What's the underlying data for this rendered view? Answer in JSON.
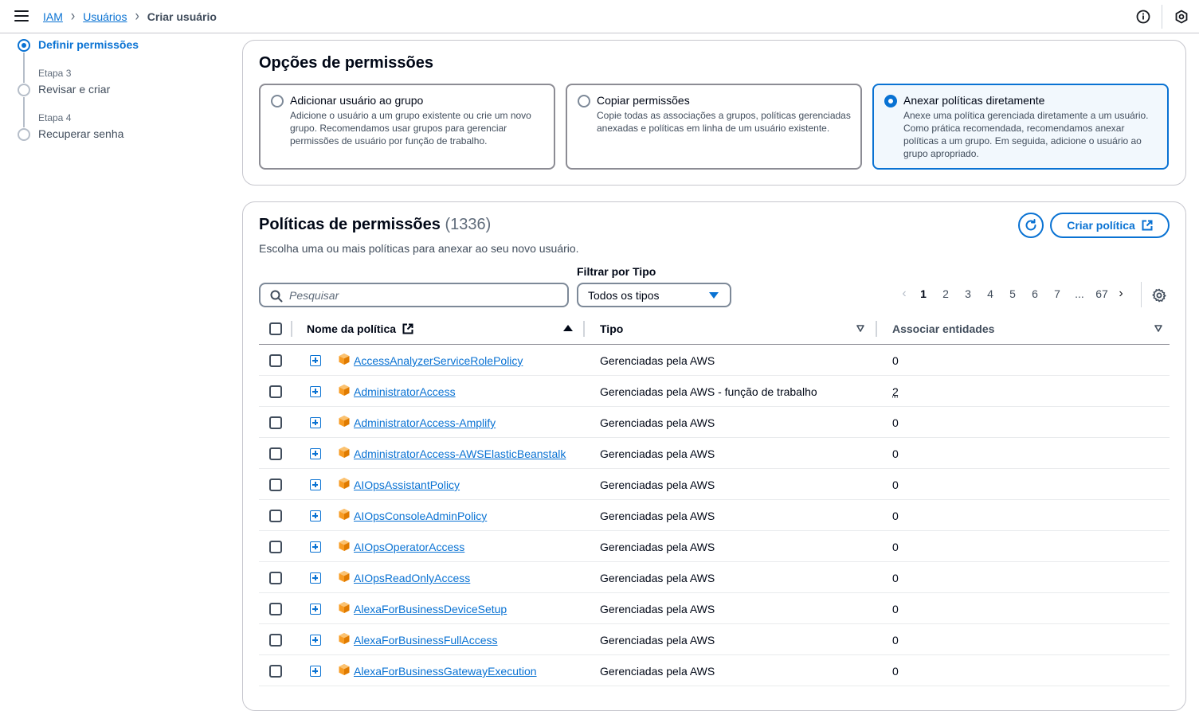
{
  "breadcrumb": {
    "root": "IAM",
    "parent": "Usuários",
    "current": "Criar usuário"
  },
  "steps": [
    {
      "sub": "",
      "title": "Definir permissões",
      "active": true
    },
    {
      "sub": "Etapa 3",
      "title": "Revisar e criar",
      "active": false
    },
    {
      "sub": "Etapa 4",
      "title": "Recuperar senha",
      "active": false
    }
  ],
  "permission_options": {
    "title": "Opções de permissões",
    "tiles": [
      {
        "title": "Adicionar usuário ao grupo",
        "desc": "Adicione o usuário a um grupo existente ou crie um novo grupo. Recomendamos usar grupos para gerenciar permissões de usuário por função de trabalho.",
        "selected": false
      },
      {
        "title": "Copiar permissões",
        "desc": "Copie todas as associações a grupos, políticas gerenciadas anexadas e políticas em linha de um usuário existente.",
        "selected": false
      },
      {
        "title": "Anexar políticas diretamente",
        "desc": "Anexe uma política gerenciada diretamente a um usuário. Como prática recomendada, recomendamos anexar políticas a um grupo. Em seguida, adicione o usuário ao grupo apropriado.",
        "selected": true
      }
    ]
  },
  "policies": {
    "title": "Políticas de permissões",
    "count": "(1336)",
    "subtitle": "Escolha uma ou mais políticas para anexar ao seu novo usuário.",
    "create_button": "Criar política",
    "filter_label": "Filtrar por Tipo",
    "search_placeholder": "Pesquisar",
    "filter_value": "Todos os tipos",
    "pagination": {
      "pages": [
        "1",
        "2",
        "3",
        "4",
        "5",
        "6",
        "7",
        "...",
        "67"
      ],
      "current": "1"
    },
    "columns": {
      "name": "Nome da política",
      "type": "Tipo",
      "entities": "Associar entidades"
    },
    "rows": [
      {
        "name": "AccessAnalyzerServiceRolePolicy",
        "type": "Gerenciadas pela AWS",
        "entities": "0"
      },
      {
        "name": "AdministratorAccess",
        "type": "Gerenciadas pela AWS - função de trabalho",
        "entities": "2"
      },
      {
        "name": "AdministratorAccess-Amplify",
        "type": "Gerenciadas pela AWS",
        "entities": "0"
      },
      {
        "name": "AdministratorAccess-AWSElasticBeanstalk",
        "type": "Gerenciadas pela AWS",
        "entities": "0"
      },
      {
        "name": "AIOpsAssistantPolicy",
        "type": "Gerenciadas pela AWS",
        "entities": "0"
      },
      {
        "name": "AIOpsConsoleAdminPolicy",
        "type": "Gerenciadas pela AWS",
        "entities": "0"
      },
      {
        "name": "AIOpsOperatorAccess",
        "type": "Gerenciadas pela AWS",
        "entities": "0"
      },
      {
        "name": "AIOpsReadOnlyAccess",
        "type": "Gerenciadas pela AWS",
        "entities": "0"
      },
      {
        "name": "AlexaForBusinessDeviceSetup",
        "type": "Gerenciadas pela AWS",
        "entities": "0"
      },
      {
        "name": "AlexaForBusinessFullAccess",
        "type": "Gerenciadas pela AWS",
        "entities": "0"
      },
      {
        "name": "AlexaForBusinessGatewayExecution",
        "type": "Gerenciadas pela AWS",
        "entities": "0"
      }
    ]
  },
  "icons": {
    "menu": "hamburger-icon",
    "info": "info-icon",
    "settings": "settings-icon",
    "refresh": "refresh-icon",
    "external": "external-link-icon",
    "search": "search-icon",
    "gear": "gear-icon",
    "policy": "aws-managed-policy-icon",
    "expand": "expand-plus-icon"
  },
  "colors": {
    "accent": "#0972d3",
    "aws_orange": "#f89c24",
    "border": "#c6c6cd",
    "text": "#000716"
  }
}
